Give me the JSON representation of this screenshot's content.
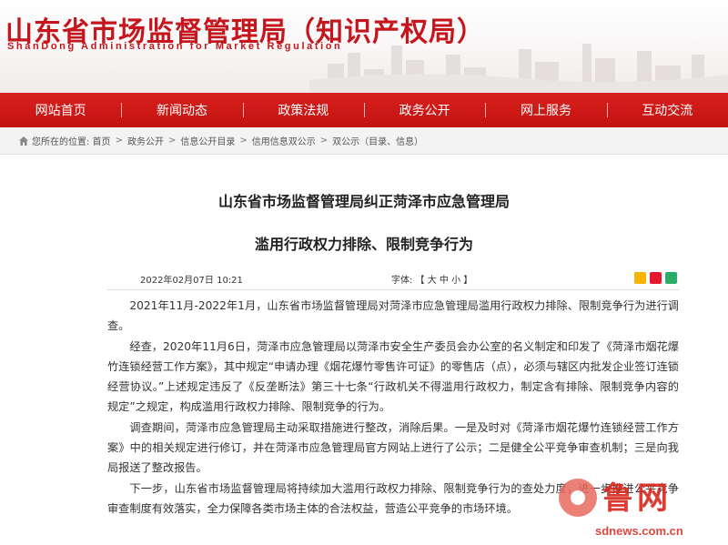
{
  "header": {
    "title": "山东省市场监督管理局（知识产权局）",
    "subtitle": "ShanDong Administration for Market Regulation"
  },
  "nav": {
    "items": [
      "网站首页",
      "新闻动态",
      "政策法规",
      "政务公开",
      "网上服务",
      "互动交流"
    ]
  },
  "breadcrumb": {
    "prefix": "您所在的位置: 首页",
    "items": [
      "政务公开",
      "信息公开目录",
      "信用信息双公示",
      "双公示（目录、信息）"
    ],
    "separator": ">"
  },
  "article": {
    "title_line1": "山东省市场监督管理局纠正菏泽市应急管理局",
    "title_line2": "滥用行政权力排除、限制竞争行为",
    "date": "2022年02月07日 10:21",
    "font_size_label": "字体: 【 大 中 小 】",
    "paragraphs": [
      "2021年11月-2022年1月，山东省市场监督管理局对菏泽市应急管理局滥用行政权力排除、限制竞争行为进行调查。",
      "经查，2020年11月6日，菏泽市应急管理局以菏泽市安全生产委员会办公室的名义制定和印发了《菏泽市烟花爆竹连锁经营工作方案》，其中规定“申请办理《烟花爆竹零售许可证》的零售店（点），必须与辖区内批发企业签订连锁经营协议。”上述规定违反了《反垄断法》第三十七条“行政机关不得滥用行政权力，制定含有排除、限制竞争内容的规定”之规定，构成滥用行政权力排除、限制竞争的行为。",
      "调查期间，菏泽市应急管理局主动采取措施进行整改，消除后果。一是及时对《菏泽市烟花爆竹连锁经营工作方案》中的相关规定进行修订，并在菏泽市应急管理局官方网站上进行了公示；二是健全公平竞争审查机制；三是向我局报送了整改报告。",
      "下一步，山东省市场监督管理局将持续加大滥用行政权力排除、限制竞争行为的查处力度，进一步推进公平竞争审查制度有效落实，全力保障各类市场主体的合法权益，营造公平竞争的市场环境。"
    ]
  },
  "watermark": {
    "brand": "鲁网",
    "url": "sdnews.com.cn"
  },
  "colors": {
    "brand_red": "#c4161c",
    "nav_red": "#cf1a17",
    "crumb_bg": "#f3f3f3"
  }
}
